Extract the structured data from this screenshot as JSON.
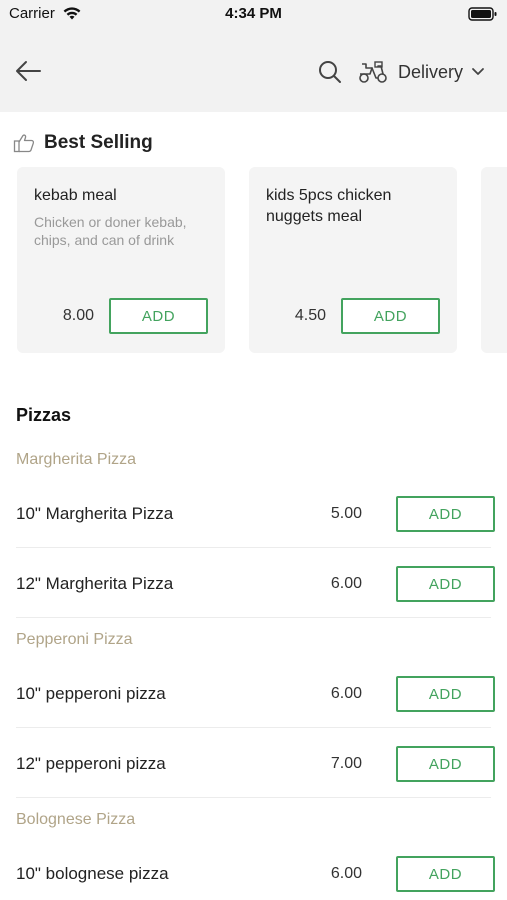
{
  "status_bar": {
    "carrier": "Carrier",
    "time": "4:34 PM"
  },
  "header": {
    "delivery_label": "Delivery"
  },
  "best_selling": {
    "title": "Best Selling",
    "cards": [
      {
        "name": "kebab meal",
        "description": "Chicken or doner kebab, chips, and can of drink",
        "price": "8.00",
        "add_label": "ADD"
      },
      {
        "name": "kids 5pcs chicken nuggets meal",
        "description": "",
        "price": "4.50",
        "add_label": "ADD"
      }
    ]
  },
  "menu": {
    "category": "Pizzas",
    "subcategories": [
      {
        "title": "Margherita Pizza",
        "items": [
          {
            "name": "10\" Margherita Pizza",
            "price": "5.00",
            "add_label": "ADD"
          },
          {
            "name": "12\" Margherita Pizza",
            "price": "6.00",
            "add_label": "ADD"
          }
        ]
      },
      {
        "title": "Pepperoni Pizza",
        "items": [
          {
            "name": "10\" pepperoni pizza",
            "price": "6.00",
            "add_label": "ADD"
          },
          {
            "name": "12\" pepperoni pizza",
            "price": "7.00",
            "add_label": "ADD"
          }
        ]
      },
      {
        "title": "Bolognese Pizza",
        "items": [
          {
            "name": "10\" bolognese pizza",
            "price": "6.00",
            "add_label": "ADD"
          }
        ]
      }
    ]
  },
  "icons": {
    "wifi": "wifi-icon",
    "battery": "battery-icon",
    "back": "back-arrow-icon",
    "search": "search-icon",
    "delivery": "scooter-icon",
    "dropdown": "chevron-down-icon",
    "best_selling": "thumbs-up-icon"
  },
  "colors": {
    "accent_green": "#43a35e",
    "subcategory_text": "#b0a488",
    "header_bg": "#f2f2f2",
    "card_bg": "#f4f4f4"
  }
}
